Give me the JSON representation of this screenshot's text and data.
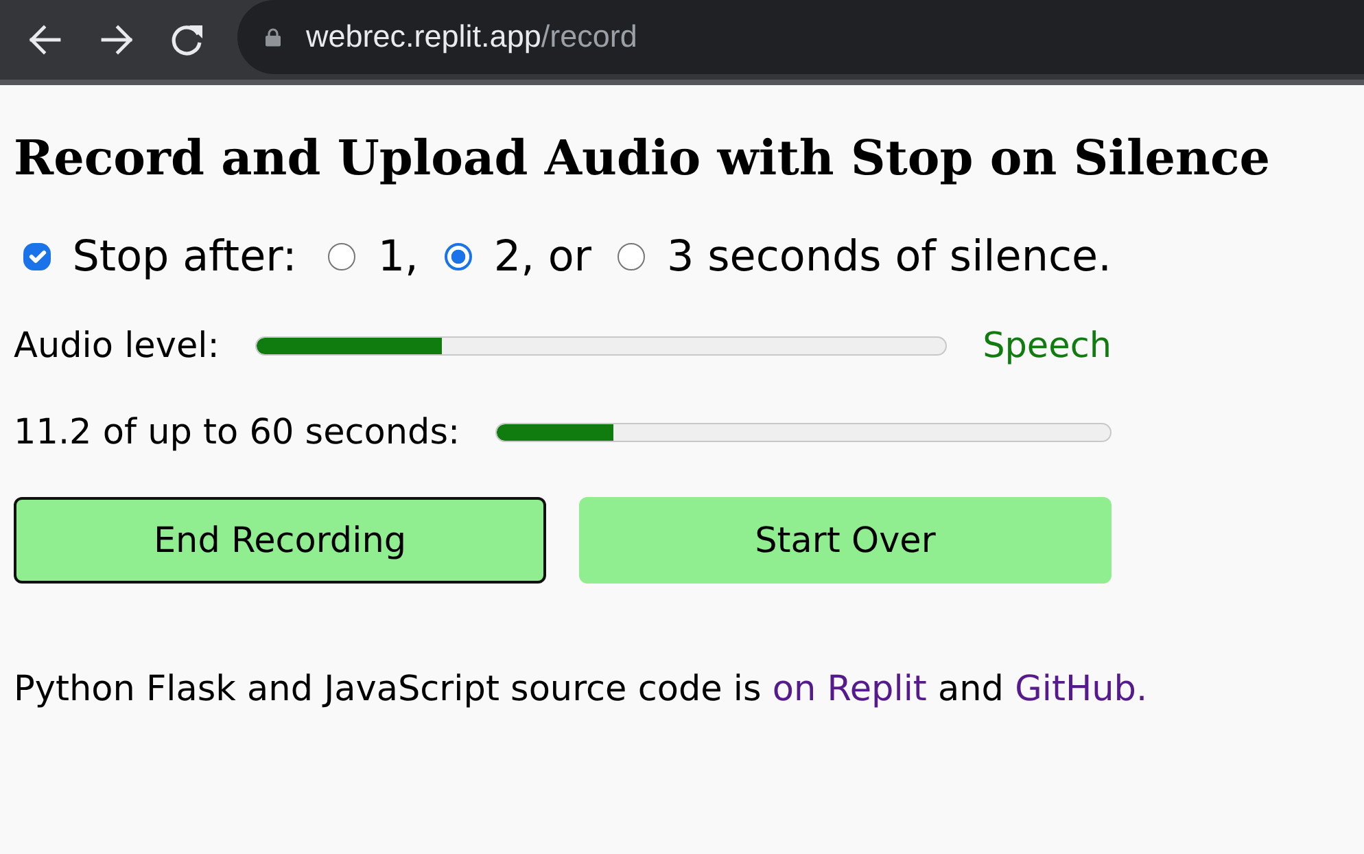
{
  "browser": {
    "address_host": "webrec.replit.app",
    "address_path": "/record"
  },
  "heading": "Record and Upload Audio with Stop on Silence",
  "stop_option": {
    "checked": true,
    "label": "Stop after:",
    "choices": [
      {
        "label": "1,",
        "selected": false
      },
      {
        "label": "2, or",
        "selected": true
      },
      {
        "label": "3 seconds of silence.",
        "selected": false
      }
    ]
  },
  "audio_level": {
    "label": "Audio level:",
    "level": 0.27,
    "reading": "Speech"
  },
  "duration": {
    "label": "11.2 of up to 60 seconds:",
    "level": 0.19
  },
  "buttons": [
    {
      "label": "End Recording",
      "focused": true
    },
    {
      "label": "Start Over",
      "focused": false
    }
  ],
  "footer": {
    "parts": [
      {
        "kind": "text",
        "text": "Python Flask and JavaScript source code is"
      },
      {
        "kind": "link",
        "text": "on Replit"
      },
      {
        "kind": "text",
        "text": "and"
      },
      {
        "kind": "link",
        "text": "GitHub."
      }
    ]
  }
}
